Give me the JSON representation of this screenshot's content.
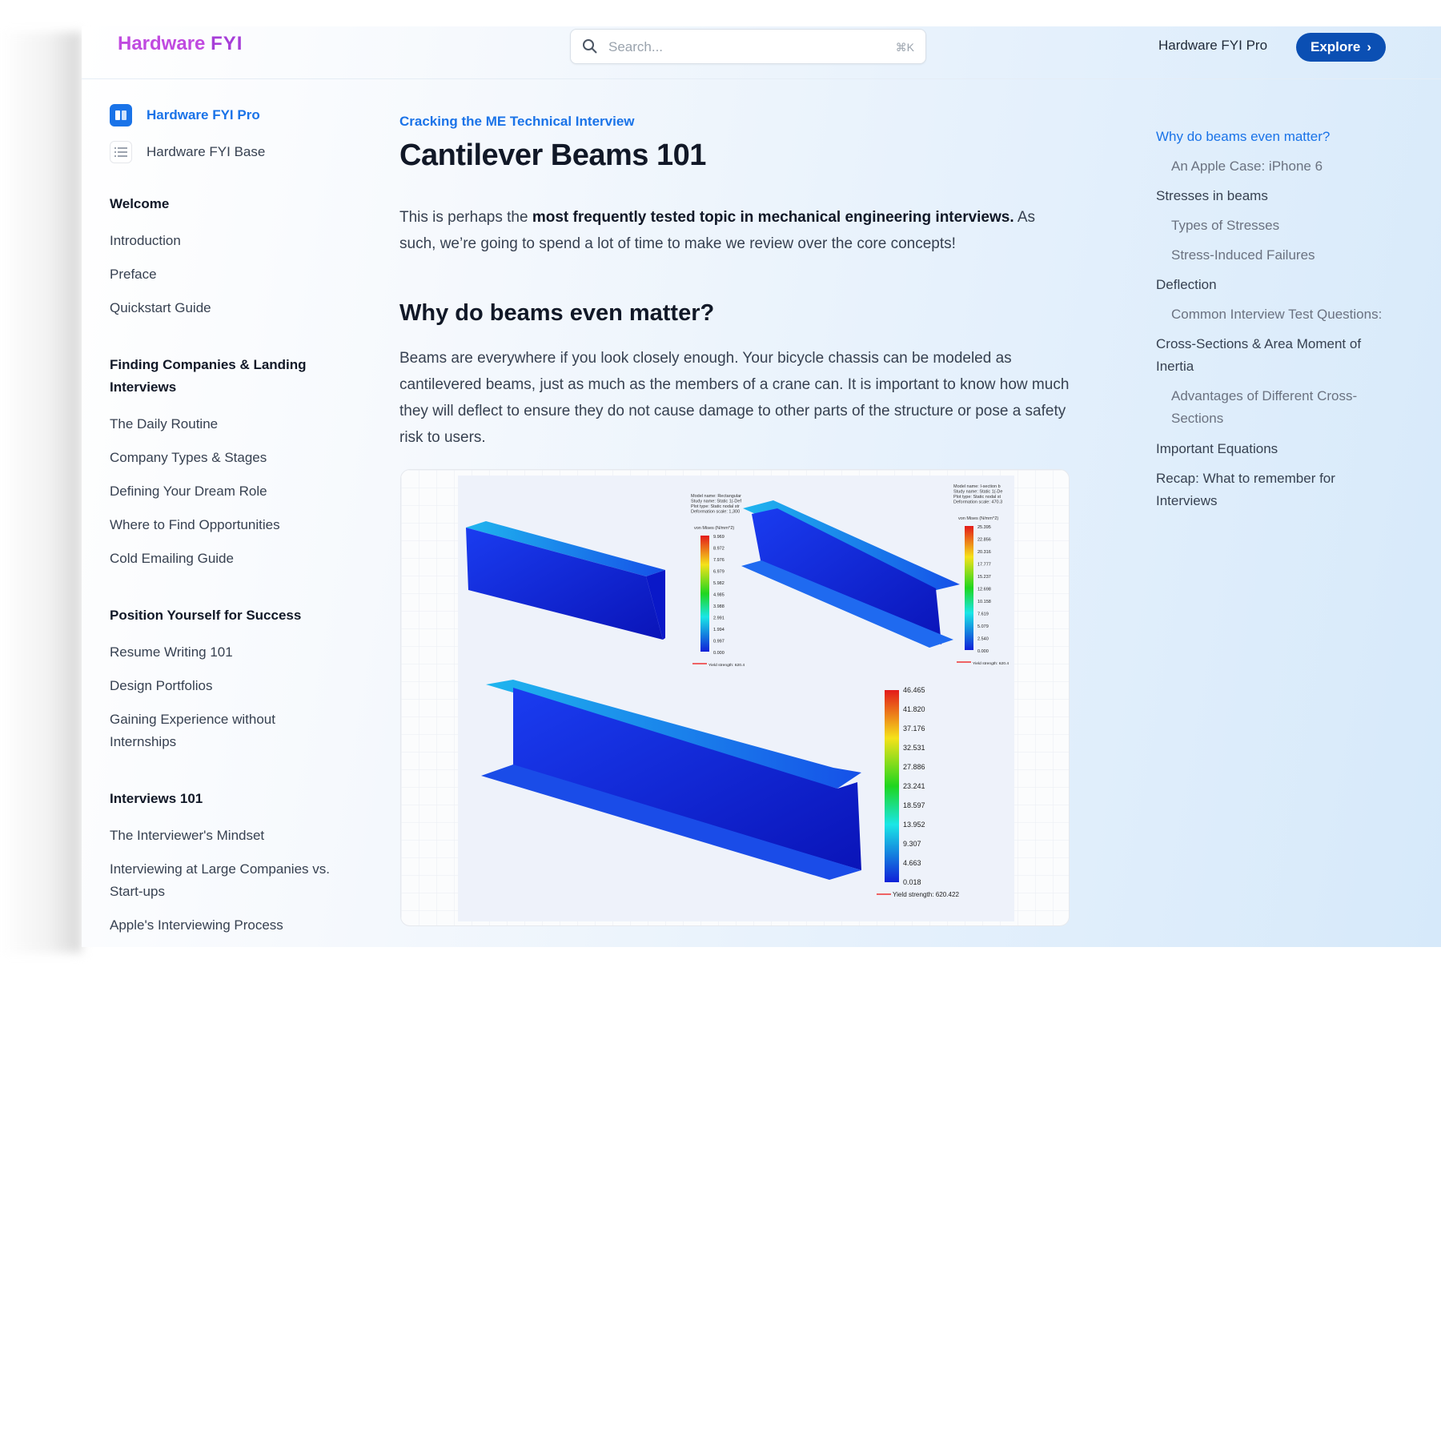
{
  "header": {
    "logo_text": "Hardware",
    "logo_mark": "FYI",
    "search_placeholder": "Search...",
    "search_shortcut": "⌘K",
    "pro_link": "Hardware FYI Pro",
    "explore_label": "Explore",
    "explore_chevron": "›"
  },
  "sidebar": {
    "top": [
      {
        "label": "Hardware FYI Pro",
        "icon": "book-icon",
        "active": true
      },
      {
        "label": "Hardware FYI Base",
        "icon": "list-icon",
        "active": false
      }
    ],
    "sections": [
      {
        "title": "Welcome",
        "items": [
          "Introduction",
          "Preface",
          "Quickstart Guide"
        ]
      },
      {
        "title": "Finding Companies & Landing Interviews",
        "items": [
          "The Daily Routine",
          "Company Types & Stages",
          "Defining Your Dream Role",
          "Where to Find Opportunities",
          "Cold Emailing Guide"
        ]
      },
      {
        "title": "Position Yourself for Success",
        "items": [
          "Resume Writing 101",
          "Design Portfolios",
          "Gaining Experience without Internships"
        ]
      },
      {
        "title": "Interviews 101",
        "items": [
          "The Interviewer's Mindset",
          "Interviewing at Large Companies vs. Start-ups",
          "Apple's Interviewing Process"
        ]
      }
    ]
  },
  "main": {
    "breadcrumb": "Cracking the ME Technical Interview",
    "title": "Cantilever Beams 101",
    "intro_pre": "This is perhaps the ",
    "intro_bold": "most frequently tested topic in mechanical engineering interviews.",
    "intro_post": " As such, we’re going to spend a lot of time to make we review over the core concepts!",
    "h2": "Why do beams even matter?",
    "para2": "Beams are everywhere if you look closely enough. Your bicycle chassis can be modeled as cantilevered beams, just as much as the members of a crane can. It is important to know how much they will deflect to ensure they do not cause damage to other parts of the structure or pose a safety risk to users.",
    "figure": {
      "plot1": {
        "info": [
          "Model name: Rectangular",
          "Study name: Static 1(-Def",
          "Plot type: Static nodal str",
          "Deformation scale: 1,300"
        ],
        "unit": "von Mises (N/mm^2)",
        "values": [
          "9.969",
          "8.972",
          "7.976",
          "6.979",
          "5.982",
          "4.985",
          "3.988",
          "2.991",
          "1.994",
          "0.997",
          "0.000"
        ],
        "yield": "Yield strength: 620.4"
      },
      "plot2": {
        "info": [
          "Model name: I-section b",
          "Study name: Static 1(-De",
          "Plot type: Static nodal st",
          "Deformation scale: 470.3"
        ],
        "unit": "von Mises (N/mm^2)",
        "values": [
          "25.395",
          "22.856",
          "20.316",
          "17.777",
          "15.237",
          "12.698",
          "10.158",
          "7.619",
          "5.079",
          "2.540",
          "0.000"
        ],
        "yield": "Yield strength: 620.4"
      },
      "plot3": {
        "values": [
          "46.465",
          "41.820",
          "37.176",
          "32.531",
          "27.886",
          "23.241",
          "18.597",
          "13.952",
          "9.307",
          "4.663",
          "0.018"
        ],
        "yield": "Yield strength: 620.422"
      }
    }
  },
  "toc": [
    {
      "label": "Why do beams even matter?",
      "level": 1,
      "active": true
    },
    {
      "label": "An Apple Case: iPhone 6",
      "level": 2
    },
    {
      "label": "Stresses in beams",
      "level": 1
    },
    {
      "label": "Types of Stresses",
      "level": 2
    },
    {
      "label": "Stress-Induced Failures",
      "level": 2
    },
    {
      "label": "Deflection",
      "level": 1
    },
    {
      "label": "Common Interview Test Questions:",
      "level": 2
    },
    {
      "label": "Cross-Sections & Area Moment of Inertia",
      "level": 1
    },
    {
      "label": "Advantages of Different Cross-Sections",
      "level": 2
    },
    {
      "label": "Important Equations",
      "level": 1
    },
    {
      "label": "Recap: What to remember for Interviews",
      "level": 1
    }
  ],
  "colors": {
    "accent": "#1a73e8",
    "button": "#0b4fb3",
    "logo": "#c04ae0"
  }
}
